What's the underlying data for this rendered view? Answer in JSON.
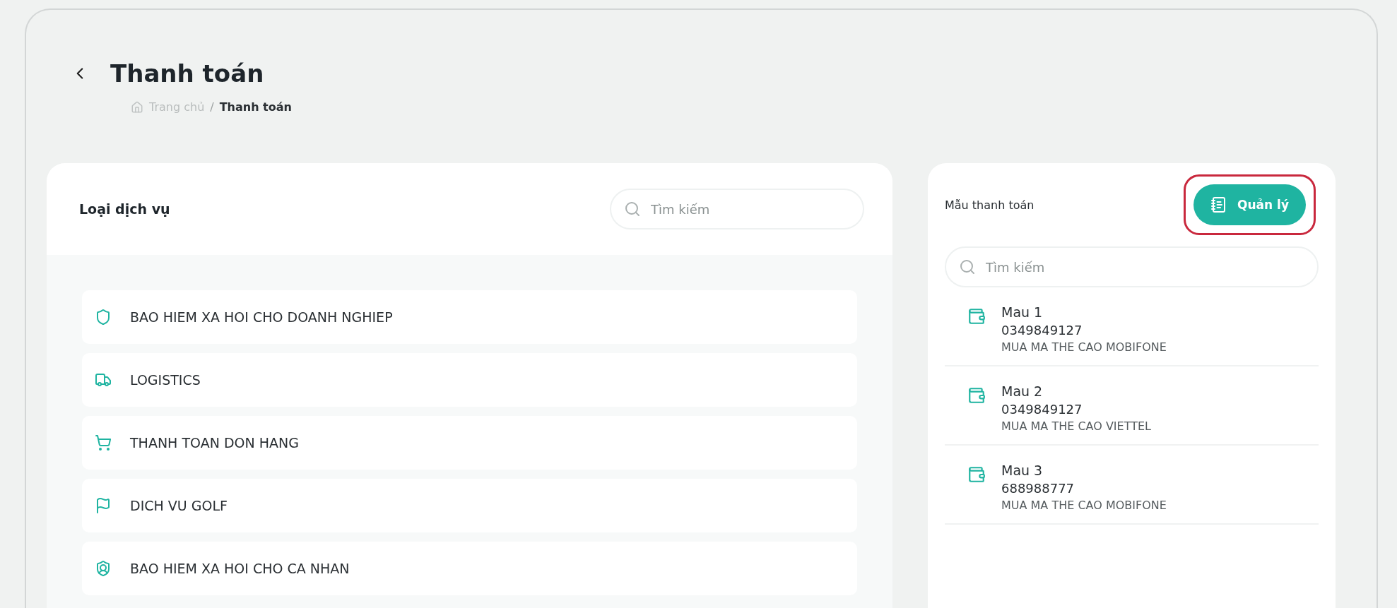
{
  "page": {
    "title": "Thanh toán",
    "breadcrumb_separator": "/",
    "breadcrumb": [
      {
        "label": "Trang chủ",
        "current": false
      },
      {
        "label": "Thanh toán",
        "current": true
      }
    ]
  },
  "services": {
    "title": "Loại dịch vụ",
    "search": {
      "placeholder": "Tìm kiếm"
    },
    "items": [
      {
        "label": "BAO HIEM XA HOI CHO DOANH NGHIEP"
      },
      {
        "label": "LOGISTICS"
      },
      {
        "label": "THANH TOAN DON HANG"
      },
      {
        "label": "DICH VU GOLF"
      },
      {
        "label": "BAO HIEM XA HOI CHO CA NHAN"
      }
    ]
  },
  "templates": {
    "title": "Mẫu thanh toán",
    "manage_button": {
      "label": "Quản lý",
      "highlighted": true
    },
    "search": {
      "placeholder": "Tìm kiếm"
    },
    "items": [
      {
        "name": "Mau 1",
        "number": "0349849127",
        "description": "MUA MA THE CAO MOBIFONE"
      },
      {
        "name": "Mau 2",
        "number": "0349849127",
        "description": "MUA MA THE CAO VIETTEL"
      },
      {
        "name": "Mau 3",
        "number": "688988777",
        "description": "MUA MA THE CAO MOBIFONE"
      }
    ]
  }
}
